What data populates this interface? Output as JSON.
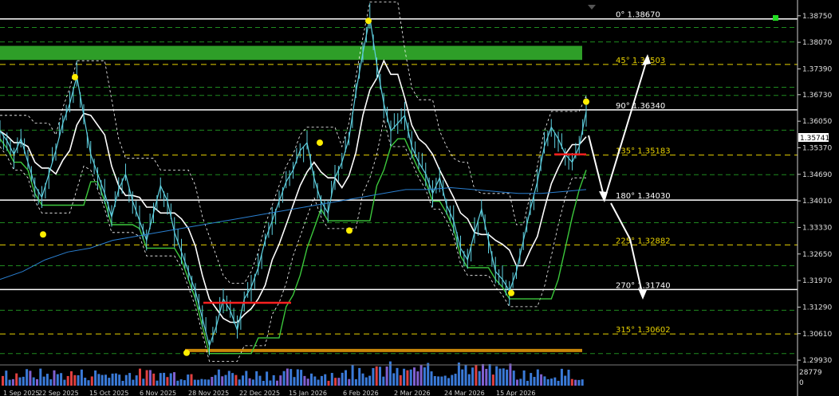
{
  "price_axis": {
    "ticks": [
      "1.38750",
      "1.38070",
      "1.37390",
      "1.36730",
      "1.36050",
      "1.35370",
      "1.34690",
      "1.34010",
      "1.33330",
      "1.32650",
      "1.31970",
      "1.31290",
      "1.30610",
      "1.29930"
    ],
    "current_price": "1.35741",
    "range": [
      1.2985,
      1.3895
    ]
  },
  "volume_axis": {
    "max_label": "28779",
    "min_label": "0"
  },
  "fib_levels": [
    {
      "angle": "0°",
      "price": "1.38670",
      "value": 1.3867,
      "color": "#ffffff",
      "style": "solid"
    },
    {
      "angle": "45°",
      "price": "1.37503",
      "value": 1.37503,
      "color": "#e8d200",
      "style": "dashed"
    },
    {
      "angle": "90°",
      "price": "1.36340",
      "value": 1.3634,
      "color": "#ffffff",
      "style": "solid"
    },
    {
      "angle": "135°",
      "price": "1.35183",
      "value": 1.35183,
      "color": "#e8d200",
      "style": "dashed"
    },
    {
      "angle": "180°",
      "price": "1.34030",
      "value": 1.3403,
      "color": "#ffffff",
      "style": "solid"
    },
    {
      "angle": "225°",
      "price": "1.32882",
      "value": 1.32882,
      "color": "#e8d200",
      "style": "dashed"
    },
    {
      "angle": "270°",
      "price": "1.31740",
      "value": 1.3174,
      "color": "#ffffff",
      "style": "solid"
    },
    {
      "angle": "315°",
      "price": "1.30602",
      "value": 1.30602,
      "color": "#e8d200",
      "style": "dashed"
    }
  ],
  "green_grid_levels": [
    1.3845,
    1.3808,
    1.3692,
    1.3671,
    1.3582,
    1.3468,
    1.3345,
    1.3235,
    1.3121,
    1.301
  ],
  "green_zone": {
    "top": 1.3798,
    "bottom": 1.3762,
    "color": "#2e9e28"
  },
  "support_line": {
    "value": 1.3018,
    "color": "#c8860a"
  },
  "date_axis": [
    "1 Sep 2025",
    "22 Sep 2025",
    "15 Oct 2025",
    "6 Nov 2025",
    "28 Nov 2025",
    "22 Dec 2025",
    "15 Jan 2026",
    "6 Feb 2026",
    "2 Mar 2026",
    "24 Mar 2026",
    "15 Apr 2026"
  ],
  "colors": {
    "price": "#5fd0e0",
    "ma": "#2a7fd0",
    "trail": "#3cc83c",
    "band": "#ffffff",
    "arrow": "#ffffff",
    "red_mark": "#ff2020",
    "fractal": "#ffee00"
  },
  "chart_data": {
    "type": "line",
    "series": [
      {
        "values": [
          1.358,
          1.3555,
          1.352,
          1.356,
          1.35,
          1.344,
          1.341,
          1.347,
          1.353,
          1.36,
          1.365,
          1.372,
          1.362,
          1.352,
          1.347,
          1.342,
          1.336,
          1.343,
          1.347,
          1.34,
          1.335,
          1.33,
          1.337,
          1.344,
          1.34,
          1.332,
          1.327,
          1.322,
          1.317,
          1.31,
          1.303,
          1.308,
          1.315,
          1.312,
          1.307,
          1.315,
          1.318,
          1.323,
          1.33,
          1.335,
          1.34,
          1.345,
          1.348,
          1.353,
          1.355,
          1.346,
          1.34,
          1.337,
          1.346,
          1.35,
          1.356,
          1.368,
          1.378,
          1.387,
          1.375,
          1.365,
          1.358,
          1.36,
          1.362,
          1.354,
          1.35,
          1.347,
          1.342,
          1.346,
          1.339,
          1.335,
          1.328,
          1.325,
          1.332,
          1.338,
          1.33,
          1.322,
          1.32,
          1.317,
          1.322,
          1.33,
          1.338,
          1.345,
          1.354,
          1.359,
          1.356,
          1.352,
          1.35,
          1.354,
          1.363
        ]
      },
      {
        "values": [
          1.32,
          1.322,
          1.325,
          1.327,
          1.328,
          1.33,
          1.331,
          1.332,
          1.333,
          1.334,
          1.335,
          1.336,
          1.337,
          1.338,
          1.339,
          1.34,
          1.341,
          1.342,
          1.343,
          1.343,
          1.3435,
          1.343,
          1.3425,
          1.342,
          1.342,
          1.3425,
          1.343
        ]
      }
    ],
    "ylim": [
      1.2985,
      1.3895
    ]
  }
}
